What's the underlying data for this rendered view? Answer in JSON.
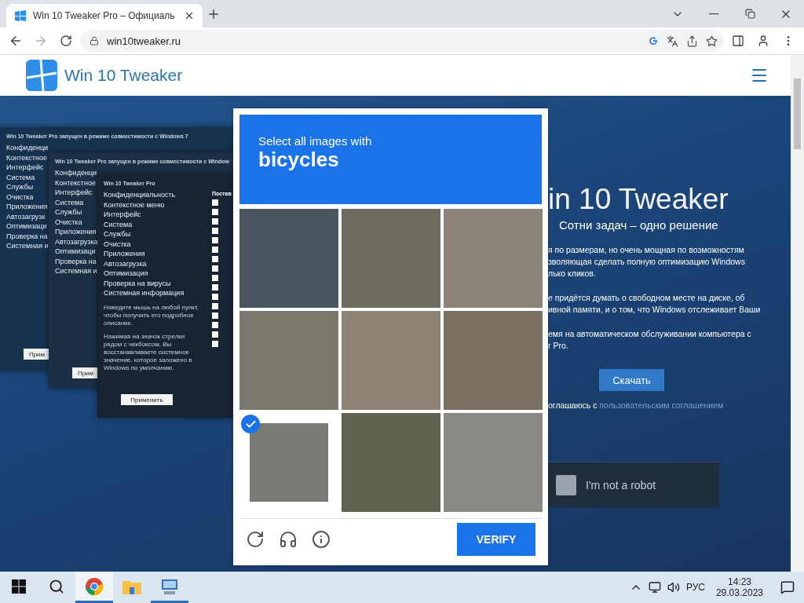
{
  "browser": {
    "tab": {
      "title": "Win 10 Tweaker Pro – Официаль"
    },
    "address": "win10tweaker.ru"
  },
  "site": {
    "logo": "Win 10 Tweaker",
    "app_windows": [
      {
        "title": "Win 10 Tweaker Pro запущен в режиме совместимости с Windows 7",
        "menu": [
          "Конфиденци",
          "Контекстное",
          "Интерфейс",
          "Система",
          "Службы",
          "Очистка",
          "Приложения",
          "Автозагрузк",
          "Оптимизаци",
          "Проверка на",
          "Системная и"
        ],
        "button": "Прим"
      },
      {
        "title": "Win 10 Tweaker Pro запущен в режиме совместимости с Window",
        "menu": [
          "Конфиденци",
          "Контекстное",
          "Интерфейс",
          "Система",
          "Службы",
          "Очистка",
          "Приложения",
          "Автозагрузка",
          "Оптимизаци",
          "Проверка на",
          "Системная и"
        ],
        "button": "Прим"
      },
      {
        "title": "Win 10 Tweaker Pro",
        "menu": [
          "Конфиденциальность",
          "Контекстное меню",
          "Интерфейс",
          "Система",
          "Службы",
          "Очистка",
          "Приложения",
          "Автозагрузка",
          "Оптимизация",
          "Проверка на вирусы",
          "Системная информация"
        ],
        "hints": [
          "Наведите мышь на любой пункт, чтобы получить его подробное описание.",
          "Нажимая на значок стрелки рядом с чекбоксом, Вы восстанавливаете системное значение, которое заложено в Windows по умолчанию."
        ],
        "button": "Применить",
        "column_heading": "Постав",
        "checkboxes": [
          {
            "checked": false
          },
          {
            "checked": false
          },
          {
            "checked": false
          },
          {
            "checked": false
          },
          {
            "checked": false
          },
          {
            "checked": false
          },
          {
            "checked": false
          },
          {
            "checked": false
          },
          {
            "checked": false
          },
          {
            "checked": false
          },
          {
            "checked": false
          },
          {
            "checked": false
          },
          {
            "checked": false
          },
          {
            "checked": false
          },
          {
            "checked": false
          },
          {
            "checked": false
          }
        ]
      }
    ],
    "hero": {
      "title": "in 10 Tweaker",
      "subtitle": "Сотни задач – одно решение",
      "paragraphs": [
        "я по размерам, но очень мощная по возможностям\nзволяющая сделать полную оптимизацию Windows\nлько кликов.",
        "е придётся думать о свободном месте на диске, об\nивной памяти, и о том, что Windows отслеживает Ваши",
        "емя на автоматическом обслуживании компьютера с\nr Pro."
      ],
      "download_button": "Скачать",
      "agreement": "оглашаюсь с ",
      "agreement_link": "пользовательским соглашением"
    },
    "recaptcha": {
      "label": "I'm not a robot",
      "checked": false
    }
  },
  "captcha": {
    "prompt": "Select all images with",
    "target": "bicycles",
    "tiles": [
      {
        "selected": false
      },
      {
        "selected": false
      },
      {
        "selected": false
      },
      {
        "selected": false
      },
      {
        "selected": false
      },
      {
        "selected": false
      },
      {
        "selected": true
      },
      {
        "selected": false
      },
      {
        "selected": false
      }
    ],
    "verify": "VERIFY"
  },
  "taskbar": {
    "apps": [
      {
        "kind": "chrome",
        "active": true
      },
      {
        "kind": "folder",
        "active": false
      },
      {
        "kind": "tweaker",
        "active": true
      }
    ],
    "language": "РУС",
    "time": "14:23",
    "date": "29.03.2023"
  }
}
